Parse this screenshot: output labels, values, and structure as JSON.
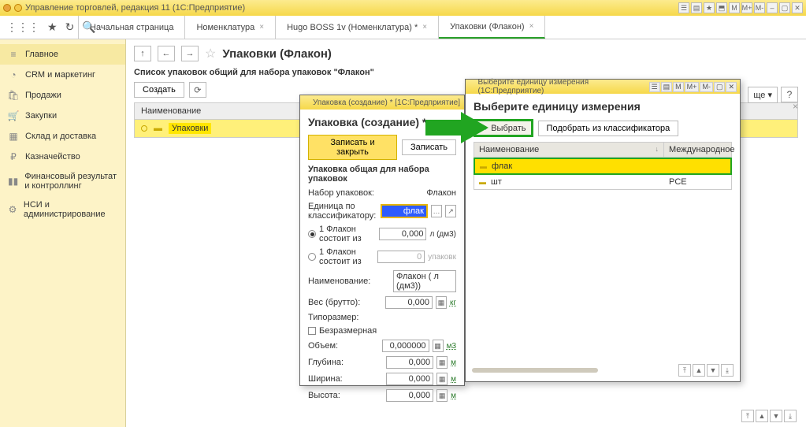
{
  "app": {
    "title": "Управление торговлей, редакция 11  (1С:Предприятие)"
  },
  "tabs": {
    "t0": "Начальная страница",
    "t1": "Номенклатура",
    "t2": "Hugo BOSS 1v (Номенклатура) *",
    "t3": "Упаковки (Флакон)"
  },
  "sidebar": {
    "main": "Главное",
    "crm": "CRM и маркетинг",
    "sales": "Продажи",
    "purch": "Закупки",
    "stock": "Склад и доставка",
    "treas": "Казначейство",
    "fin": "Финансовый результат и контроллинг",
    "nsi": "НСИ и администрирование"
  },
  "page": {
    "title": "Упаковки (Флакон)",
    "subtitle": "Список упаковок общий для набора упаковок \"Флакон\"",
    "create": "Создать",
    "more": "ще ▾",
    "help": "?",
    "col_name": "Наименование",
    "row1": "Упаковки"
  },
  "dlg1": {
    "wintitle": "Упаковка (создание) *  [1С:Предприятие]",
    "heading": "Упаковка (создание) *",
    "save_close": "Записать и закрыть",
    "save": "Записать",
    "section": "Упаковка общая для набора упаковок",
    "l_set": "Набор упаковок:",
    "v_set": "Флакон",
    "l_class": "Единица по классификатору:",
    "v_class": "флак",
    "r1": "1 Флакон состоит из",
    "r1v": "0,000",
    "r1u": "л (дм3)",
    "r2": "1 Флакон состоит из",
    "r2v": "0",
    "r2u": "упаковк",
    "l_name": "Наименование:",
    "v_name": "Флакон ( л (дм3))",
    "l_weight": "Вес (брутто):",
    "v_weight": "0,000",
    "u_weight": "кг",
    "l_type": "Типоразмер:",
    "l_nosize": "Безразмерная",
    "l_vol": "Объем:",
    "v_vol": "0,000000",
    "u_vol": "м3",
    "l_depth": "Глубина:",
    "l_width": "Ширина:",
    "l_height": "Высота:",
    "v_dim": "0,000",
    "u_dim": "м"
  },
  "dlg2": {
    "wintitle": "Выберите единицу измерения  (1С:Предприятие)",
    "heading": "Выберите единицу измерения",
    "choose": "Выбрать",
    "pick": "Подобрать из классификатора",
    "col1": "Наименование",
    "col2": "Международное",
    "r1": "флак",
    "r2": "шт",
    "r2b": "PCE"
  },
  "titlebar_btns": {
    "m": "M",
    "mp": "M+",
    "mm": "M-"
  }
}
